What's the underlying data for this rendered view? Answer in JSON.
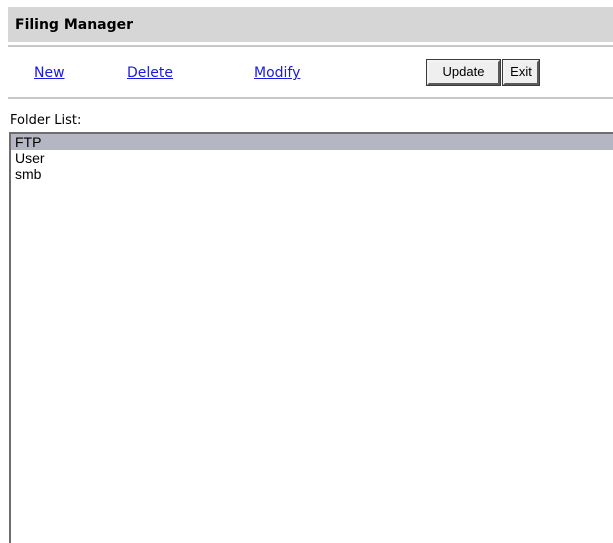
{
  "window": {
    "title": "Filing Manager"
  },
  "toolbar": {
    "new_label": "New",
    "delete_label": "Delete",
    "modify_label": "Modify",
    "update_label": "Update",
    "exit_label": "Exit"
  },
  "folder_list": {
    "label": "Folder List:",
    "items": [
      "FTP",
      "User",
      "smb"
    ],
    "selected": "FTP"
  },
  "colors": {
    "title_bar": "#d6d6d6",
    "link": "#1a1ae0",
    "selection": "#b4b6c4"
  }
}
